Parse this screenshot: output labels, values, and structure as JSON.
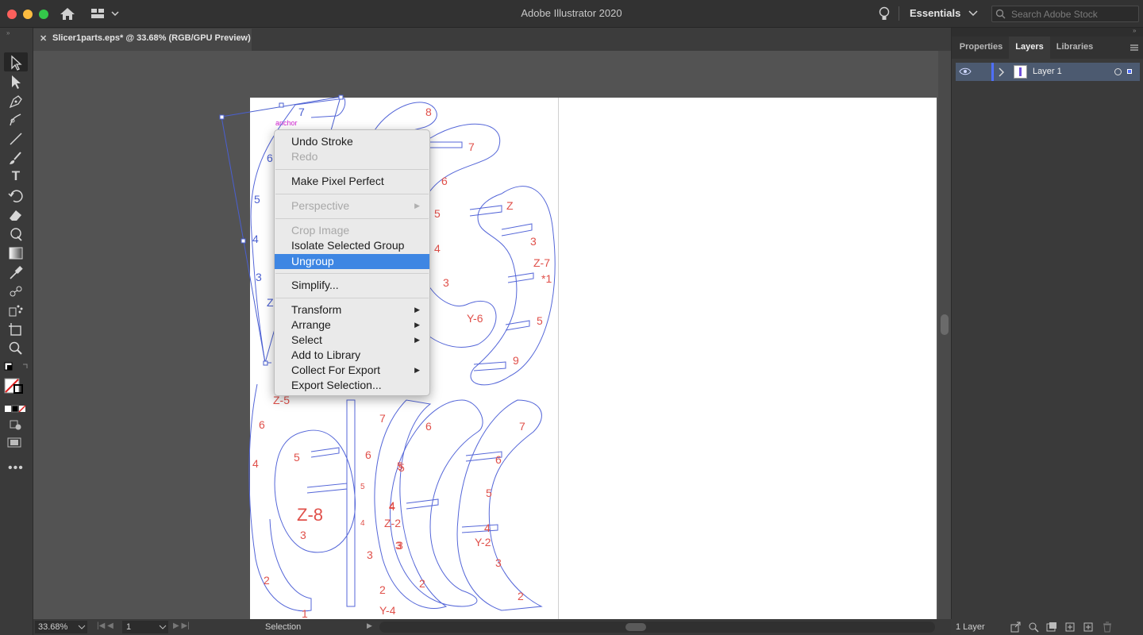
{
  "app": {
    "title": "Adobe Illustrator 2020",
    "workspace": "Essentials",
    "search_placeholder": "Search Adobe Stock"
  },
  "document": {
    "tab_title": "Slicer1parts.eps* @ 33.68% (RGB/GPU Preview)"
  },
  "canvas": {
    "anchor_label": "anchor"
  },
  "context_menu": {
    "items": [
      {
        "label": "Undo Stroke"
      },
      {
        "label": "Redo"
      },
      {
        "label": "Make Pixel Perfect"
      },
      {
        "label": "Perspective"
      },
      {
        "label": "Crop Image"
      },
      {
        "label": "Isolate Selected Group"
      },
      {
        "label": "Ungroup"
      },
      {
        "label": "Simplify..."
      },
      {
        "label": "Transform"
      },
      {
        "label": "Arrange"
      },
      {
        "label": "Select"
      },
      {
        "label": "Add to Library"
      },
      {
        "label": "Collect For Export"
      },
      {
        "label": "Export Selection..."
      }
    ]
  },
  "panel": {
    "tabs": [
      "Properties",
      "Layers",
      "Libraries"
    ],
    "layer_name": "Layer 1",
    "layer_count": "1 Layer"
  },
  "status": {
    "zoom": "33.68%",
    "artboard": "1",
    "tool": "Selection"
  },
  "art_labels": {
    "left": [
      "7",
      "6",
      "5",
      "4",
      "3",
      "Z",
      "Z-5",
      "6",
      "5",
      "4",
      "3",
      "2",
      "1"
    ],
    "mid": [
      "8",
      "7",
      "6",
      "5",
      "4",
      "3",
      "Y-6",
      "7",
      "6",
      "5",
      "4",
      "3",
      "2",
      "Y-4",
      "5",
      "4",
      "3",
      "Z-8"
    ],
    "right": [
      "Z",
      "3",
      "Z-7",
      "*1",
      "5",
      "9",
      "6",
      "5",
      "4",
      "Z-2",
      "3",
      "2",
      "7",
      "6",
      "5",
      "4",
      "Y-2",
      "3",
      "2"
    ]
  },
  "colors": {
    "accent": "#3e86e3",
    "path": "#4a5fd0",
    "label": "#e0504a"
  }
}
